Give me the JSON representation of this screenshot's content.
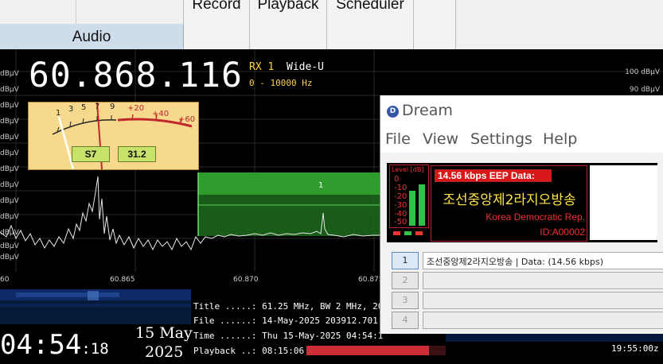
{
  "toolbar": {
    "audio_label": "Audio",
    "record_label": "Record",
    "playback_label": "Playback",
    "scheduler_label": "Scheduler"
  },
  "receiver": {
    "frequency": "60.868.116",
    "rx": "RX 1",
    "mode": "Wide-U",
    "bandwidth": "0 - 10000 Hz",
    "s_meter_value": "S7",
    "s_meter_db": "31.2",
    "s_meter_scale_left": [
      "1",
      "3",
      "5",
      "7",
      "9"
    ],
    "s_meter_scale_right": [
      "+20",
      "+40",
      "+60"
    ],
    "db_labels_left": [
      "dBµV",
      "dBµV",
      "dBµV",
      "dBµV",
      "dBµV",
      "dBµV",
      "dBµV",
      "dBµV",
      "dBµV",
      "dBµV",
      "dBµV",
      "dBµV",
      "dBµV"
    ],
    "db_labels_right": [
      "100 dBµV",
      "90 dBµV"
    ],
    "freq_axis": [
      "60",
      "60.865",
      "60.870",
      "60.875"
    ],
    "passband_marker": "1"
  },
  "info": {
    "title_line": "Title .....: 61.25 MHz, BW 2 MHz, 20",
    "file_line": "File ......: 14-May-2025 203912.701",
    "time_line": "Time ......: Thu 15-May-2025 04:54:1",
    "playback_line": "Playback ..: 08:15:06",
    "playback_progress": 0.88
  },
  "clock": {
    "time_hm": "04:54",
    "time_s": ":18",
    "day_month": "15 May",
    "year": "2025",
    "utc": "19:55:00z"
  },
  "dream": {
    "title": "Dream",
    "logo_letter": "D",
    "menu": [
      "File",
      "View",
      "Settings",
      "Help"
    ],
    "level_title": "Level [dB]",
    "level_ticks": [
      "0",
      "-10",
      "-20",
      "-30",
      "-40",
      "-50"
    ],
    "rate_label": "14.56 kbps EEP  Data:",
    "station_label": "조선중앙제2라지오방송",
    "country_label": "Korea Democratic Rep.",
    "id_label": "ID:A00002",
    "services": [
      {
        "number": "1",
        "text": "조선중앙제2라지오방송  |   Data: (14.56 kbps)"
      },
      {
        "number": "2",
        "text": ""
      },
      {
        "number": "3",
        "text": ""
      },
      {
        "number": "4",
        "text": ""
      }
    ],
    "colors": {
      "accent_red": "#d81818",
      "level_green": "#2fc247",
      "station_yellow": "#ffe34a"
    }
  }
}
